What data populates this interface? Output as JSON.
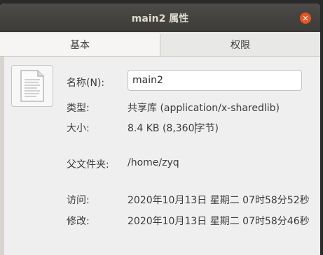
{
  "window": {
    "title": "main2 属性"
  },
  "tabs": [
    {
      "label": "基本",
      "active": true
    },
    {
      "label": "权限",
      "active": false
    }
  ],
  "icon": {
    "name": "text-file-icon"
  },
  "fields": {
    "name_label": "名称(N):",
    "name_value": "main2",
    "type_label": "类型:",
    "type_value": "共享库 (application/x-sharedlib)",
    "size_label": "大小:",
    "size_value_a": "8.4 KB (8,360",
    "size_value_b": "字节)",
    "parent_label": "父文件夹:",
    "parent_value": "/home/zyq",
    "access_label": "访问:",
    "access_value": "2020年10月13日 星期二 07时58分52秒",
    "modified_label": "修改:",
    "modified_value": "2020年10月13日 星期二 07时58分46秒"
  },
  "colors": {
    "close_button": "#e95420",
    "titlebar": "#3c3b37"
  }
}
